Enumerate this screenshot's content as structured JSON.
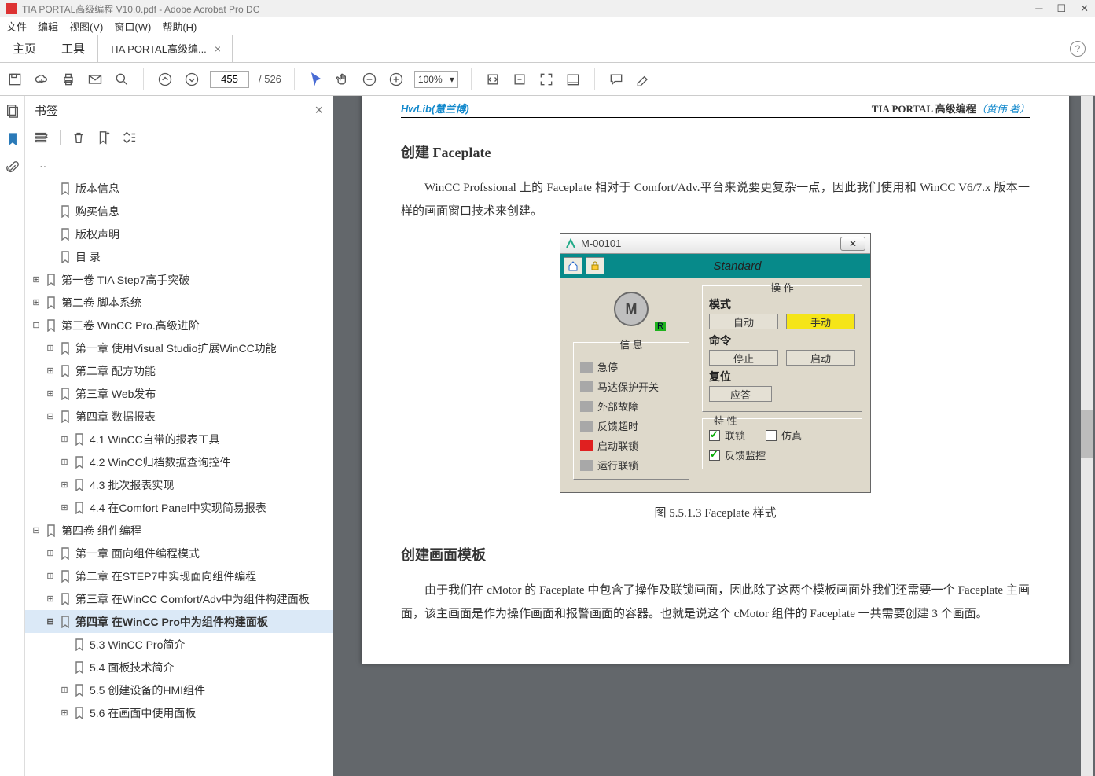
{
  "titlebar": {
    "text": "TIA PORTAL高级编程 V10.0.pdf - Adobe Acrobat Pro DC"
  },
  "menu": [
    "文件",
    "编辑",
    "视图(V)",
    "窗口(W)",
    "帮助(H)"
  ],
  "maintabs": {
    "home": "主页",
    "tools": "工具",
    "doc": "TIA PORTAL高级编...",
    "close": "×"
  },
  "toolbar": {
    "page": "455",
    "total": "/ 526",
    "zoom": "100%"
  },
  "bookmarks": {
    "title": "书签",
    "dots": "··",
    "items": [
      {
        "indent": 1,
        "exp": "",
        "label": "版本信息"
      },
      {
        "indent": 1,
        "exp": "",
        "label": "购买信息"
      },
      {
        "indent": 1,
        "exp": "",
        "label": "版权声明"
      },
      {
        "indent": 1,
        "exp": "",
        "label": "目 录"
      },
      {
        "indent": 0,
        "exp": "⊞",
        "label": "第一卷 TIA Step7高手突破"
      },
      {
        "indent": 0,
        "exp": "⊞",
        "label": "第二卷 脚本系统"
      },
      {
        "indent": 0,
        "exp": "⊟",
        "label": "第三卷 WinCC Pro.高级进阶"
      },
      {
        "indent": 1,
        "exp": "⊞",
        "label": "第一章 使用Visual Studio扩展WinCC功能"
      },
      {
        "indent": 1,
        "exp": "⊞",
        "label": "第二章 配方功能"
      },
      {
        "indent": 1,
        "exp": "⊞",
        "label": "第三章 Web发布"
      },
      {
        "indent": 1,
        "exp": "⊟",
        "label": "第四章 数据报表"
      },
      {
        "indent": 2,
        "exp": "⊞",
        "label": "4.1 WinCC自带的报表工具"
      },
      {
        "indent": 2,
        "exp": "⊞",
        "label": "4.2 WinCC归档数据查询控件"
      },
      {
        "indent": 2,
        "exp": "⊞",
        "label": "4.3 批次报表实现"
      },
      {
        "indent": 2,
        "exp": "⊞",
        "label": "4.4 在Comfort Panel中实现简易报表"
      },
      {
        "indent": 0,
        "exp": "⊟",
        "label": "第四卷 组件编程"
      },
      {
        "indent": 1,
        "exp": "⊞",
        "label": "第一章 面向组件编程模式"
      },
      {
        "indent": 1,
        "exp": "⊞",
        "label": "第二章 在STEP7中实现面向组件编程"
      },
      {
        "indent": 1,
        "exp": "⊞",
        "label": "第三章 在WinCC Comfort/Adv中为组件构建面板"
      },
      {
        "indent": 1,
        "exp": "⊟",
        "label": "第四章 在WinCC Pro中为组件构建面板",
        "sel": true
      },
      {
        "indent": 2,
        "exp": "",
        "label": "5.3 WinCC Pro简介"
      },
      {
        "indent": 2,
        "exp": "",
        "label": "5.4 面板技术简介"
      },
      {
        "indent": 2,
        "exp": "⊞",
        "label": "5.5 创建设备的HMI组件"
      },
      {
        "indent": 2,
        "exp": "⊞",
        "label": "5.6 在画面中使用面板"
      }
    ]
  },
  "doc": {
    "headL": "HwLib(慧兰博)",
    "headR1": "TIA PORTAL 高级编程",
    "headR2": "（黄伟 著）",
    "h1": "创建 Faceplate",
    "p1": "WinCC Profssional 上的 Faceplate 相对于 Comfort/Adv.平台来说要更复杂一点，因此我们使用和 WinCC V6/7.x 版本一样的画面窗口技术来创建。",
    "figcap": "图 5.5.1.3 Faceplate 样式",
    "h2": "创建画面模板",
    "p2": "由于我们在 cMotor 的 Faceplate 中包含了操作及联锁画面，因此除了这两个模板画面外我们还需要一个 Faceplate 主画面，该主画面是作为操作画面和报警画面的容器。也就是说这个 cMotor 组件的 Faceplate 一共需要创建 3 个画面。"
  },
  "faceplate": {
    "title": "M-00101",
    "tab": "Standard",
    "motor": "M",
    "rbadge": "R",
    "infoTitle": "信 息",
    "signals": [
      "急停",
      "马达保护开关",
      "外部故障",
      "反馈超时",
      "启动联锁",
      "运行联锁"
    ],
    "opTitle": "操 作",
    "modeLabel": "模式",
    "mode": [
      "自动",
      "手动"
    ],
    "cmdLabel": "命令",
    "cmd": [
      "停止",
      "启动"
    ],
    "resetLabel": "复位",
    "reset": "应答",
    "propTitle": "特 性",
    "props": [
      "联锁",
      "仿真",
      "反馈监控"
    ]
  }
}
